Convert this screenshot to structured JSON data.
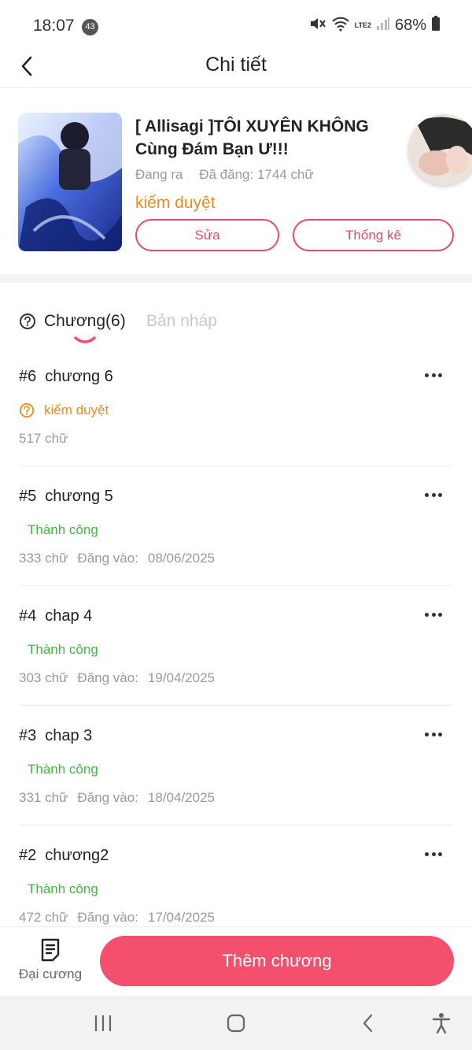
{
  "status_bar": {
    "time": "18:07",
    "notification_count": "43",
    "network": "LTE2",
    "battery": "68%"
  },
  "header": {
    "title": "Chi tiết"
  },
  "book": {
    "title": "[ Allisagi ]TÔI XUYÊN KHÔNG Cùng Đám Bạn Ư!!!",
    "publish_state": "Đang ra",
    "word_count": "Đã đăng: 1744 chữ",
    "review_status": "kiểm duyệt",
    "edit_label": "Sửa",
    "stats_label": "Thống kê"
  },
  "tabs": {
    "chapters": "Chương(6)",
    "drafts": "Bản nháp"
  },
  "chapters": [
    {
      "num": "#6",
      "title": "chương 6",
      "status": "kiểm duyệt",
      "status_type": "review",
      "words": "517 chữ",
      "posted_label": "",
      "date": ""
    },
    {
      "num": "#5",
      "title": "chương 5",
      "status": "Thành công",
      "status_type": "success",
      "words": "333 chữ",
      "posted_label": "Đăng vào:",
      "date": "08/06/2025"
    },
    {
      "num": "#4",
      "title": "chap 4",
      "status": "Thành công",
      "status_type": "success",
      "words": "303 chữ",
      "posted_label": "Đăng vào:",
      "date": "19/04/2025"
    },
    {
      "num": "#3",
      "title": "chap 3",
      "status": "Thành công",
      "status_type": "success",
      "words": "331 chữ",
      "posted_label": "Đăng vào:",
      "date": "18/04/2025"
    },
    {
      "num": "#2",
      "title": "chương2",
      "status": "Thành công",
      "status_type": "success",
      "words": "472 chữ",
      "posted_label": "Đăng vào:",
      "date": "17/04/2025"
    }
  ],
  "bottom_bar": {
    "outline_label": "Đại cương",
    "add_chapter_label": "Thêm chương"
  },
  "colors": {
    "accent": "#f2506c",
    "review": "#f08a1c",
    "success": "#3fb83f"
  }
}
